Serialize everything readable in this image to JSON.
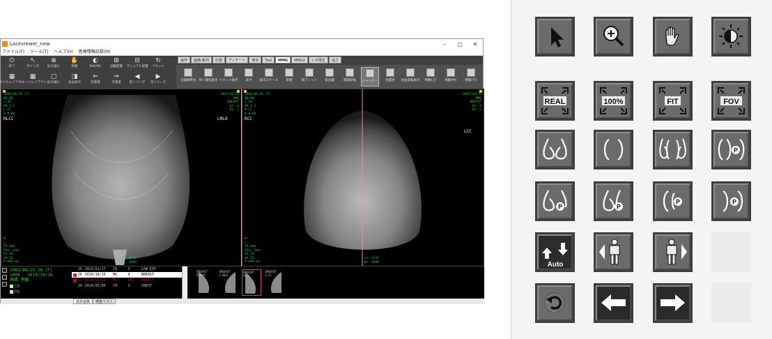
{
  "window": {
    "title": "Laceviewer_new",
    "menu": [
      "ファイル(F)",
      "ツール(T)",
      "ヘルプ(H)",
      "医療情報記録(M)"
    ],
    "min_glyph": "–",
    "max_glyph": "□",
    "close_glyph": "✕"
  },
  "left_tools": [
    {
      "label": "終了",
      "glyph": "⏻"
    },
    {
      "label": "ポインタ",
      "glyph": "↖"
    },
    {
      "label": "拡大縮小",
      "glyph": "⊕"
    },
    {
      "label": "移動",
      "glyph": "✋"
    },
    {
      "label": "WW/WL",
      "glyph": "◐"
    },
    {
      "label": "自動配置",
      "glyph": "⊞"
    },
    {
      "label": "マニュアル配置",
      "glyph": "⊟"
    },
    {
      "label": "リセット",
      "glyph": "↻"
    },
    {
      "label": "タイルレイアウト",
      "glyph": "▦"
    },
    {
      "label": "イメージレイアウト",
      "glyph": "▦"
    },
    {
      "label": "拡大縮小",
      "glyph": "▢"
    },
    {
      "label": "左右表示",
      "glyph": "◨"
    },
    {
      "label": "前患者",
      "glyph": "⇐"
    },
    {
      "label": "次患者",
      "glyph": "⇒"
    },
    {
      "label": "前シリーズ",
      "glyph": "◀"
    },
    {
      "label": "次シリーズ",
      "glyph": "▶"
    }
  ],
  "tabs": [
    "操作",
    "画像/系列",
    "計測",
    "アノテート",
    "表示",
    "Tool",
    "MMG",
    "MMG2",
    "シネ再生",
    "出力"
  ],
  "active_tab": "MMG",
  "right_tools": [
    "全面標準化",
    "同一部位表示",
    "イメージ表示",
    "実寸",
    "表示スケール",
    "等倍",
    "縦フィット",
    "拡大鏡",
    "階調反転",
    "シャッター",
    "位置合",
    "左右反転表示",
    "移動(上)",
    "移動(中)",
    "移動(下)"
  ],
  "selected_right_tool": "シャッター",
  "viewer": {
    "left": {
      "tl": "2001/06/26 (F)\n00:00\n1.50\nNH 1.5\nL-CC\n0 0.00",
      "tr": "2019/10/16\nMMG\nBREAST\nSe: 4\nIm: 1",
      "view": "RLCC",
      "view_r": "LMLO",
      "bl": "W:\nL:\n25.4mm\nThk: 1mm\nkV 28\nmA 63\n0.000 mm",
      "br": "Lt: 1547\nWt: 4096"
    },
    "right": {
      "tl": "2001/06/26 (F)\n00:00\n1.50\nNH 1.5\nR-CC\n0 0.00",
      "tr": "2019/10/16\nMMG\nBREAST\nSe: 4\nIm: 2",
      "view": "RCC",
      "view_r": "LCC",
      "bl": "W:\nL:\n25.4mm\nThk: 1mm\nkV 28\nmA 63\n0.000 mm",
      "br": "Lt: 2147\nWt: 4096"
    }
  },
  "patient": {
    "line1": "1983/06/18 26 (F)",
    "line2": "1008   2019/10/16",
    "line3": "高橋 秀敏",
    "cr": "CR",
    "mg": "MG"
  },
  "studies": [
    {
      "no": "20",
      "date": "2023/01/17",
      "mod": "CR",
      "n": "3",
      "desc": "LOW EXP",
      "style": "normal"
    },
    {
      "no": "26",
      "date": "2019/10/16",
      "mod": "MG",
      "n": "4",
      "desc": "BREAST",
      "style": "sel"
    },
    {
      "no": "27",
      "date": "2019/01/12",
      "mod": "MG",
      "n": "181",
      "desc": "BREAST",
      "style": "red"
    },
    {
      "no": "20",
      "date": "2014/05/06",
      "mod": "CR",
      "n": "1",
      "desc": "CHEST",
      "style": "normal"
    }
  ],
  "thumbnails": [
    "BREAST\nR MLO",
    "BREAST\nL MLO",
    "BREAST\nR CC",
    "BREAST\nL CC"
  ],
  "bottom_tabs": [
    "過去画像",
    "検査リスト"
  ],
  "palette": {
    "real": "REAL",
    "hundred": "100%",
    "fit": "FIT",
    "fov": "FOV",
    "p": "P",
    "auto": "Auto"
  },
  "palette_icons": [
    "pointer-icon",
    "zoom-icon",
    "pan-hand-icon",
    "window-level-icon",
    "real-size-icon",
    "hundred-percent-icon",
    "fit-icon",
    "fov-icon",
    "breast-pair-mlo-icon",
    "breast-pair-cc-icon",
    "breast-quad-icon",
    "breast-cc-prior-icon",
    "breast-mlo-prior-icon",
    "breast-mlo-prior-alt-icon",
    "breast-cc-left-prior-icon",
    "breast-cc-right-prior-icon",
    "auto-sort-icon",
    "patient-prev-icon",
    "patient-next-icon",
    "reset-icon",
    "arrow-left-icon",
    "arrow-right-icon"
  ],
  "colors": {
    "overlay_text": "#2fbf4a",
    "button_face": "#6b6b6b",
    "divider": "#e0b0c0"
  }
}
